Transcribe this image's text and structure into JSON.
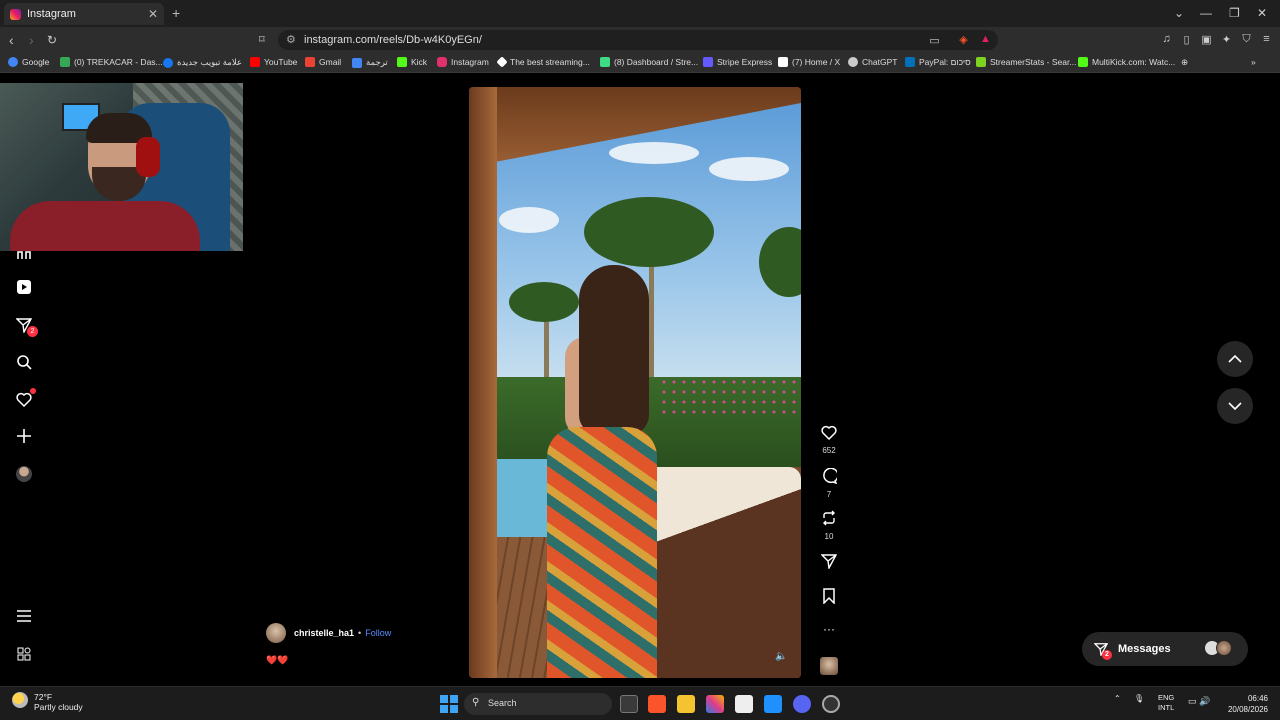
{
  "browser": {
    "tab_title": "Instagram",
    "tab_close": "✕",
    "new_tab": "+",
    "url": "instagram.com/reels/Db-w4K0yEGn/",
    "window_controls": [
      "⌄",
      "—",
      "❐",
      "✕"
    ]
  },
  "bookmarks": [
    {
      "label": "Google",
      "color": "#4285f4"
    },
    {
      "label": "(0) TREKACAR - Das...",
      "color": "#34a853"
    },
    {
      "label": "علامة تبويب جديدة",
      "color": "#1877f2"
    },
    {
      "label": "YouTube",
      "color": "#ff0000"
    },
    {
      "label": "Gmail",
      "color": "#ea4335"
    },
    {
      "label": "ترجمة",
      "color": "#4285f4"
    },
    {
      "label": "Kick",
      "color": "#53fc18"
    },
    {
      "label": "Instagram",
      "color": "#e1306c"
    },
    {
      "label": "The best streaming...",
      "color": "#ffffff"
    },
    {
      "label": "(8) Dashboard / Stre...",
      "color": "#3ddc84"
    },
    {
      "label": "Stripe Express",
      "color": "#635bff"
    },
    {
      "label": "(7) Home / X",
      "color": "#ffffff"
    },
    {
      "label": "ChatGPT",
      "color": "#cccccc"
    },
    {
      "label": "PayPal: סיכום",
      "color": "#0070ba"
    },
    {
      "label": "StreamerStats - Sear...",
      "color": "#7ed321"
    },
    {
      "label": "MultiKick.com: Watc...",
      "color": "#53fc18"
    }
  ],
  "reel": {
    "author": "christelle_ha1",
    "separator": "•",
    "follow": "Follow",
    "caption": "❤️❤️",
    "likes": "652",
    "comments": "7",
    "reposts": "10"
  },
  "sidebar": {
    "messages_badge": "2"
  },
  "messages_panel": {
    "label": "Messages",
    "badge": "2"
  },
  "taskbar": {
    "temperature": "72°F",
    "weather": "Partly cloudy",
    "search": "Search",
    "lang_top": "ENG",
    "lang_bottom": "INTL",
    "time": "06:46",
    "date": "20/08/2026"
  },
  "colors": {
    "accent_link": "#5b8cff",
    "notification_red": "#ff3040"
  }
}
